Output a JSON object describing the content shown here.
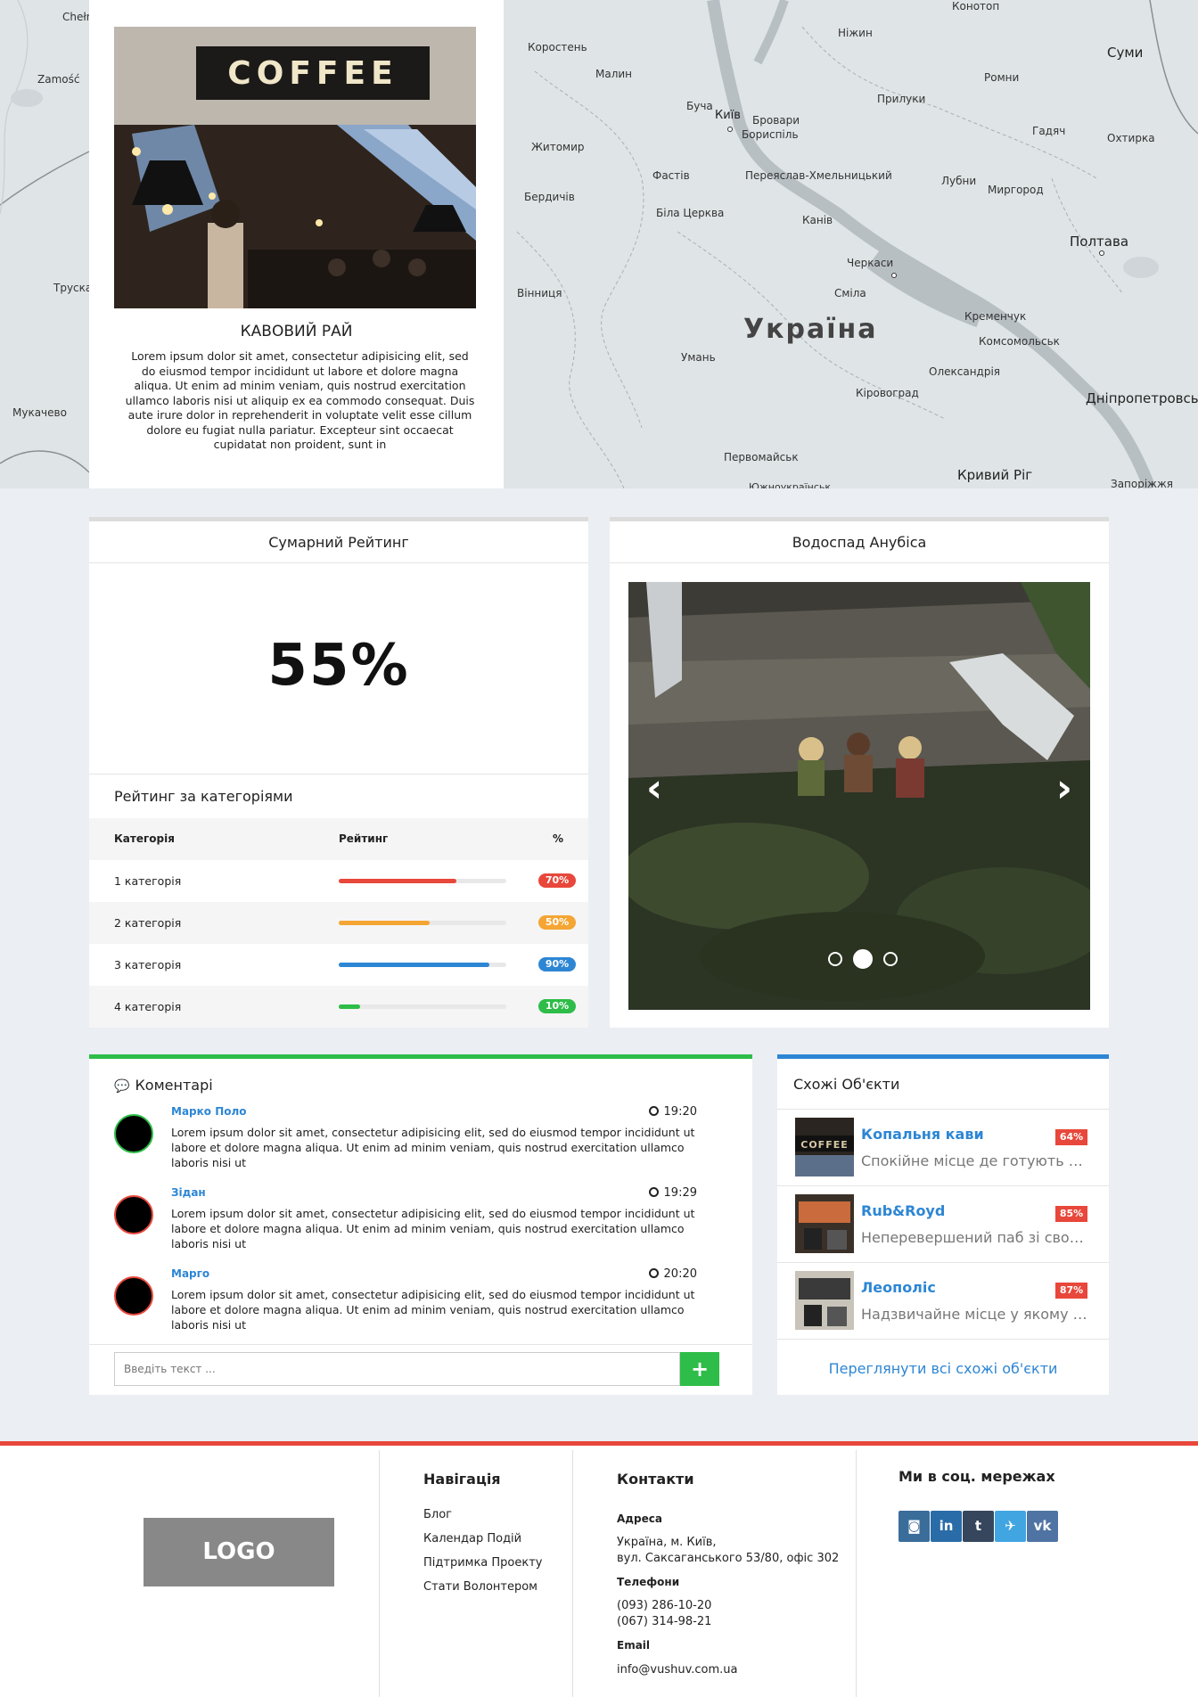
{
  "map": {
    "country_label": "Україна",
    "cities": [
      {
        "name": "Chełm"
      },
      {
        "name": "Zamość"
      },
      {
        "name": "Трускавець"
      },
      {
        "name": "Мукачево"
      },
      {
        "name": "Коростень"
      },
      {
        "name": "Малин"
      },
      {
        "name": "Буча"
      },
      {
        "name": "Київ"
      },
      {
        "name": "Бровари"
      },
      {
        "name": "Бориспіль"
      },
      {
        "name": "Житомир"
      },
      {
        "name": "Фастів"
      },
      {
        "name": "Бердичів"
      },
      {
        "name": "Біла Церква"
      },
      {
        "name": "Переяслав-Хмельницький"
      },
      {
        "name": "Вінниця"
      },
      {
        "name": "Умань"
      },
      {
        "name": "Ніжин"
      },
      {
        "name": "Прилуки"
      },
      {
        "name": "Ромни"
      },
      {
        "name": "Конотоп"
      },
      {
        "name": "Суми"
      },
      {
        "name": "Гадяч"
      },
      {
        "name": "Охтирка"
      },
      {
        "name": "Лубни"
      },
      {
        "name": "Миргород"
      },
      {
        "name": "Полтава"
      },
      {
        "name": "Канів"
      },
      {
        "name": "Черкаси"
      },
      {
        "name": "Сміла"
      },
      {
        "name": "Кременчук"
      },
      {
        "name": "Комсомольськ"
      },
      {
        "name": "Олександрія"
      },
      {
        "name": "Кіровоград"
      },
      {
        "name": "Дніпропетровськ"
      },
      {
        "name": "Первомайськ"
      },
      {
        "name": "Кривий Ріг"
      },
      {
        "name": "Запоріжжя"
      },
      {
        "name": "Южноукраїнськ"
      }
    ]
  },
  "info_card": {
    "photo_sign": "COFFEE",
    "title": "КАВОВИЙ РАЙ",
    "text": "Lorem ipsum dolor sit amet, consectetur adipisicing elit, sed do eiusmod tempor incididunt ut labore et dolore magna aliqua. Ut enim ad minim veniam, quis nostrud exercitation ullamco laboris nisi ut aliquip ex ea commodo consequat. Duis aute irure dolor in reprehenderit in voluptate velit esse cillum dolore eu fugiat nulla pariatur. Excepteur sint occaecat cupidatat non proident, sunt in"
  },
  "rating": {
    "title": "Сумарний Рейтинг",
    "total": "55%",
    "categories_title": "Рейтинг за категоріями",
    "columns": [
      "Категорія",
      "Рейтинг",
      "%"
    ],
    "rows": [
      {
        "name": "1 категорія",
        "value": 70,
        "label": "70%",
        "color": "#e8473b"
      },
      {
        "name": "2 категорія",
        "value": 54,
        "label": "50%",
        "color": "#f5a534"
      },
      {
        "name": "3 категорія",
        "value": 90,
        "label": "90%",
        "color": "#2d86d4"
      },
      {
        "name": "4 категорія",
        "value": 13,
        "label": "10%",
        "color": "#2ebd48"
      }
    ]
  },
  "slider": {
    "title": "Водоспад Анубіса",
    "prev": "‹",
    "next": "›",
    "active_index": 1,
    "slide_count": 3
  },
  "comments": {
    "title": "Коментарі",
    "items": [
      {
        "author": "Марко Поло",
        "time": "19:20",
        "text": "Lorem ipsum dolor sit amet, consectetur adipisicing elit, sed do eiusmod tempor incididunt ut labore et dolore magna aliqua. Ut enim ad minim veniam, quis nostrud exercitation ullamco laboris nisi ut",
        "ring": "#2ebd48"
      },
      {
        "author": "Зідан",
        "time": "19:29",
        "text": "Lorem ipsum dolor sit amet, consectetur adipisicing elit, sed do eiusmod tempor incididunt ut labore et dolore magna aliqua. Ut enim ad minim veniam, quis nostrud exercitation ullamco laboris nisi ut",
        "ring": "#e8473b"
      },
      {
        "author": "Марго",
        "time": "20:20",
        "text": "Lorem ipsum dolor sit amet, consectetur adipisicing elit, sed do eiusmod tempor incididunt ut labore et dolore magna aliqua. Ut enim ad minim veniam, quis nostrud exercitation ullamco laboris nisi ut",
        "ring": "#e8473b"
      }
    ],
    "input_placeholder": "Введіть текст ...",
    "send_label": "+"
  },
  "similar": {
    "title": "Схожі Об'єкти",
    "items": [
      {
        "title": "Копальня кави",
        "badge": "64%",
        "desc": "Спокійне місце де готують на..."
      },
      {
        "title": "Rub&Royd",
        "badge": "85%",
        "desc": "Неперевершений паб зі своє..."
      },
      {
        "title": "Леополіс",
        "badge": "87%",
        "desc": "Надзвичайне місце у якому тв..."
      }
    ],
    "view_all": "Переглянути всі схожі об'єкти"
  },
  "footer": {
    "logo": "LOGO",
    "nav_title": "Навігація",
    "nav_links": [
      "Блог",
      "Календар Подій",
      "Підтримка Проекту",
      "Стати Волонтером"
    ],
    "contacts_title": "Контакти",
    "address_label": "Адреса",
    "address_line1": "Україна, м. Київ,",
    "address_line2": "вул. Саксаганського 53/80, офіс 302",
    "phones_label": "Телефони",
    "phone1": "(093) 286-10-20",
    "phone2": "(067) 314-98-21",
    "email_label": "Email",
    "email": "info@vushuv.com.ua",
    "social_title": "Ми в соц. мережах",
    "social": [
      {
        "name": "instagram",
        "glyph": "◙",
        "color": "#3a6d9a"
      },
      {
        "name": "linkedin",
        "glyph": "in",
        "color": "#2a6ca8"
      },
      {
        "name": "tumblr",
        "glyph": "t",
        "color": "#36465d"
      },
      {
        "name": "twitter",
        "glyph": "✈",
        "color": "#41a5e1"
      },
      {
        "name": "vk",
        "glyph": "vk",
        "color": "#4f74a3"
      }
    ]
  }
}
